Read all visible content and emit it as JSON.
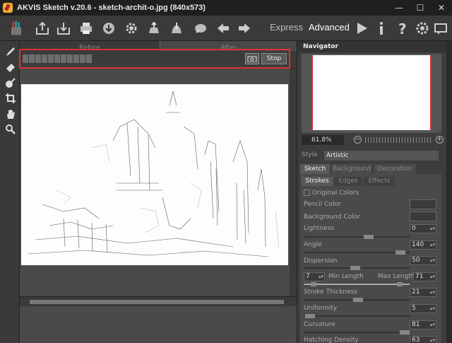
{
  "window": {
    "title": "AKVIS Sketch v.20.6 - sketch-archit-o.jpg (840x573)"
  },
  "toolbar": {
    "express_label": "Express",
    "advanced_label": "Advanced"
  },
  "view_tabs": {
    "before": "Before",
    "after": "After"
  },
  "progress": {
    "stop_label": "Stop",
    "fraction": 0.25
  },
  "navigator": {
    "title": "Navigator",
    "zoom": "61.8%"
  },
  "style": {
    "label": "Style",
    "value": "Artistic"
  },
  "tabs": [
    "Sketch",
    "Background",
    "Decoration"
  ],
  "subtabs": [
    "Strokes",
    "Edges",
    "Effects"
  ],
  "params": {
    "original_colors": "Original Colors",
    "pencil_color": "Pencil Color",
    "background_color": "Background Color",
    "lightness_label": "Lightness",
    "lightness": "0",
    "angle_label": "Angle",
    "angle": "140",
    "dispersion_label": "Dispersion",
    "dispersion": "50",
    "min_length_value": "7",
    "min_length_label": "Min Length",
    "max_length_label": "Max Length",
    "max_length_value": "71",
    "stroke_thickness_label": "Stroke Thickness",
    "stroke_thickness": "21",
    "uniformity_label": "Uniformity",
    "uniformity": "5",
    "curvature_label": "Curvature",
    "curvature": "81",
    "hatching_density_label": "Hatching Density",
    "hatching_density": "63"
  }
}
